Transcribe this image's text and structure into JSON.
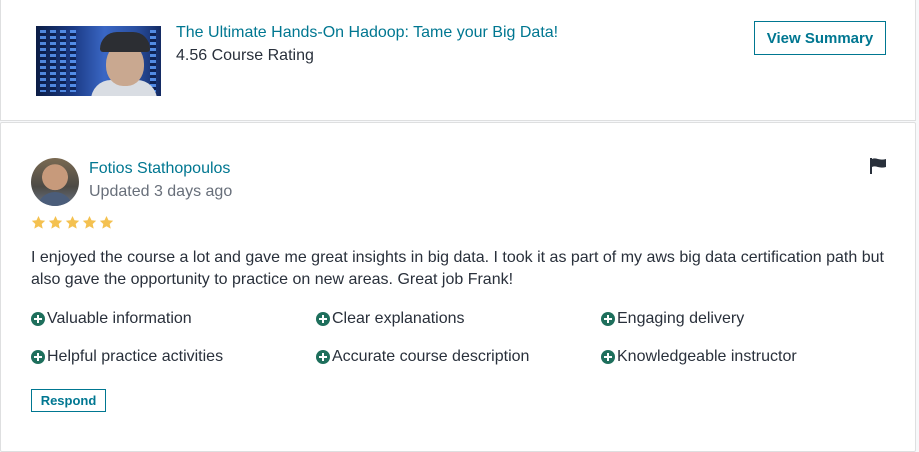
{
  "course": {
    "title": "The Ultimate Hands-On Hadoop: Tame your Big Data!",
    "rating_text": "4.56 Course Rating",
    "view_summary_label": "View Summary",
    "thumbnail_icon": "course-thumbnail-image"
  },
  "review": {
    "reviewer_name": "Fotios Stathopoulos",
    "updated": "Updated 3 days ago",
    "stars": 5,
    "text": "I enjoyed the course a lot and gave me great insights in big data. I took it as part of my aws big data certification path but also gave the opportunity to practice on new areas. Great job Frank!",
    "tags": [
      {
        "label": "Valuable information"
      },
      {
        "label": "Clear explanations"
      },
      {
        "label": "Engaging delivery"
      },
      {
        "label": "Helpful practice activities"
      },
      {
        "label": "Accurate course description"
      },
      {
        "label": "Knowledgeable instructor"
      }
    ],
    "respond_label": "Respond",
    "flag_icon": "flag-icon"
  },
  "colors": {
    "accent": "#007791",
    "star": "#f4c150",
    "tag_icon": "#1e6f5c",
    "text": "#29303b",
    "muted": "#686f7a"
  }
}
